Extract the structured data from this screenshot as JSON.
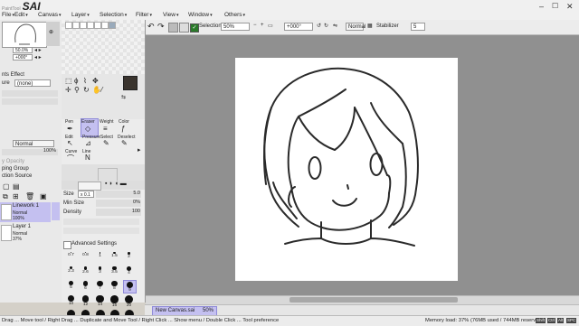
{
  "app": {
    "logo_small": "PaintTool",
    "logo_big": "SAI"
  },
  "menu": [
    {
      "label": "File"
    },
    {
      "label": "Edit"
    },
    {
      "label": "Canvas"
    },
    {
      "label": "Layer"
    },
    {
      "label": "Selection"
    },
    {
      "label": "Filter"
    },
    {
      "label": "View"
    },
    {
      "label": "Window"
    },
    {
      "label": "Others"
    }
  ],
  "toolbar": {
    "selection_label": "Selection",
    "zoom": "50%",
    "angle": "+000°",
    "blend": "Normal",
    "stabilizer_label": "Stabilizer",
    "stabilizer_value": "5"
  },
  "navigator": {
    "zoom": "50.0%",
    "angle": "+000°"
  },
  "paint_effect": {
    "title": "nts Effect",
    "texture_label": "ure",
    "texture_value": "(none)",
    "blend": "Normal",
    "opacity": "100%",
    "clip_opacity": "y Opacity",
    "clipping_group": "ping Group",
    "selection_source": "ction Source"
  },
  "layers": [
    {
      "name": "Linework 1",
      "mode": "Normal",
      "opacity": "100%",
      "selected": true
    },
    {
      "name": "Layer 1",
      "mode": "Normal",
      "opacity": "37%",
      "selected": false
    }
  ],
  "tools": {
    "names": [
      {
        "label": "Pen"
      },
      {
        "label": "Eraser"
      },
      {
        "label": "Weight"
      },
      {
        "label": "Color"
      },
      {
        "label": "Edit"
      },
      {
        "label": "Pressure"
      },
      {
        "label": "Select"
      },
      {
        "label": "Deselect"
      },
      {
        "label": "Curve"
      },
      {
        "label": "Line"
      }
    ]
  },
  "brush": {
    "size_label": "Size",
    "size_mult": "x 0.1",
    "size_value": "5.0",
    "min_size_label": "Min Size",
    "min_size_value": "0%",
    "density_label": "Density",
    "density_value": "100",
    "advanced": "Advanced Settings",
    "presets": [
      [
        "0.7",
        "0.8",
        "1",
        "1.5",
        "2"
      ],
      [
        "2.3",
        "2.6",
        "3",
        "3.5",
        "4"
      ],
      [
        "5",
        "6",
        "7",
        "8",
        "9"
      ],
      [
        "10",
        "12",
        "14",
        "16",
        "20"
      ],
      [
        "25",
        "30",
        "35",
        "40",
        "50"
      ]
    ]
  },
  "document": {
    "name": "New Canvas.sai",
    "zoom": "50%"
  },
  "status": {
    "hint": "Drag ... Move tool / Right Drag ... Duplicate and Move Tool / Right Click ... Show menu / Double Click ... Tool preference",
    "memory": "Memory load: 37% (76MB used / 744MB reserved)",
    "keys": [
      "Shift",
      "Ctrl",
      "Alt",
      "SPC"
    ]
  }
}
